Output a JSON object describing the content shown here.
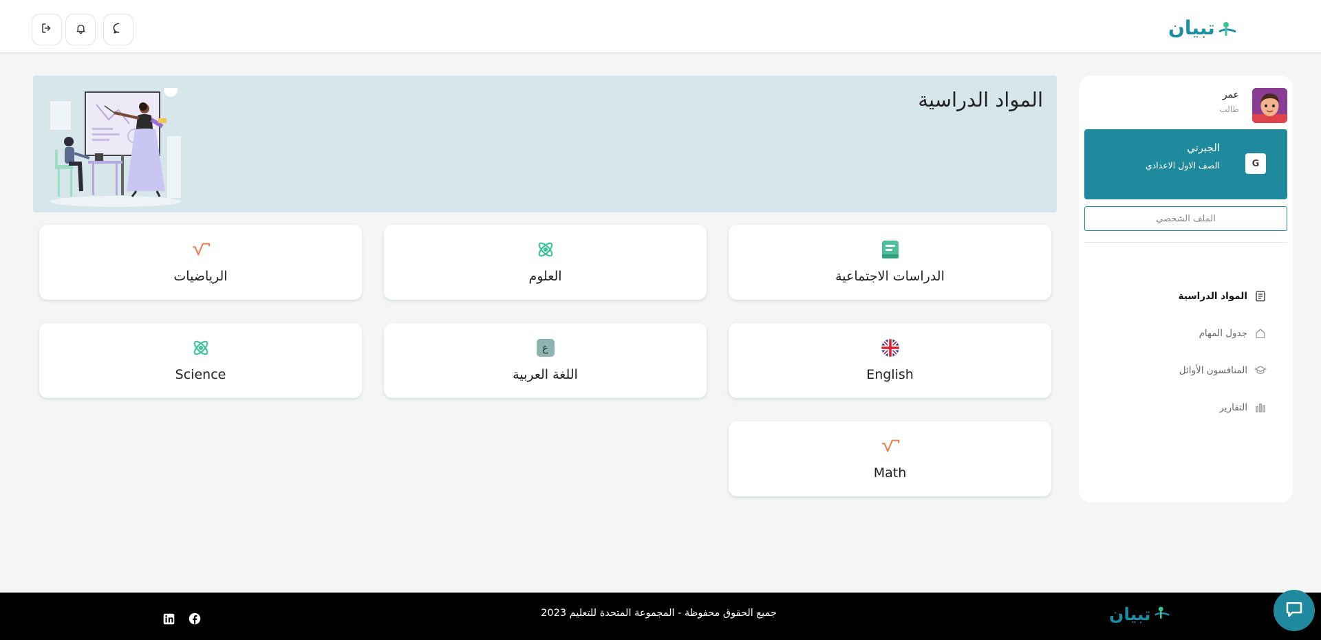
{
  "header": {
    "logo_text": "تبيان",
    "buttons": [
      {
        "name": "logout-icon"
      },
      {
        "name": "bell-icon"
      },
      {
        "name": "chat-bubble-icon"
      }
    ]
  },
  "sidebar": {
    "user_name": "عمر",
    "user_role": "طالب",
    "school_name": "الجبرتي",
    "school_grade": "الصف الاول الاعدادي",
    "school_logo_text": "G",
    "profile_button": "الملف الشخصي",
    "nav": [
      {
        "label": "المواد الدراسية",
        "icon": "book-icon",
        "active": true
      },
      {
        "label": "جدول المهام",
        "icon": "home-icon",
        "active": false
      },
      {
        "label": "المنافسون الأوائل",
        "icon": "graduation-cap-icon",
        "active": false
      },
      {
        "label": "التقارير",
        "icon": "bar-chart-icon",
        "active": false
      }
    ]
  },
  "banner": {
    "title": "المواد الدراسية"
  },
  "subjects": [
    {
      "label": "الدراسات الاجتماعية",
      "icon": "book-icon",
      "color": "#4cbf9a"
    },
    {
      "label": "العلوم",
      "icon": "atom-icon",
      "color": "#3fc49a"
    },
    {
      "label": "الرياضيات",
      "icon": "sqrt-icon",
      "color": "#f07b52"
    },
    {
      "label": "English",
      "icon": "uk-flag-icon",
      "color": "#d62033"
    },
    {
      "label": "اللغة العربية",
      "icon": "arabic-letter-icon",
      "color": "#7ba9a6",
      "glyph": "ع"
    },
    {
      "label": "Science",
      "icon": "atom-icon",
      "color": "#3fc49a"
    },
    {
      "label": "Math",
      "icon": "sqrt-icon",
      "color": "#f07b52"
    }
  ],
  "footer": {
    "copyright": "جميع الحقوق محفوظة - المجموعة المتحدة للتعليم 2023",
    "logo_text": "تبيان",
    "social": [
      "linkedin-icon",
      "facebook-icon"
    ]
  },
  "colors": {
    "primary": "#1f8a9e",
    "banner_bg": "#d7e6ea",
    "page_bg": "#f5f5f5",
    "footer_bg": "#000000",
    "accent_green": "#3fc49a",
    "accent_orange": "#f07b52"
  }
}
